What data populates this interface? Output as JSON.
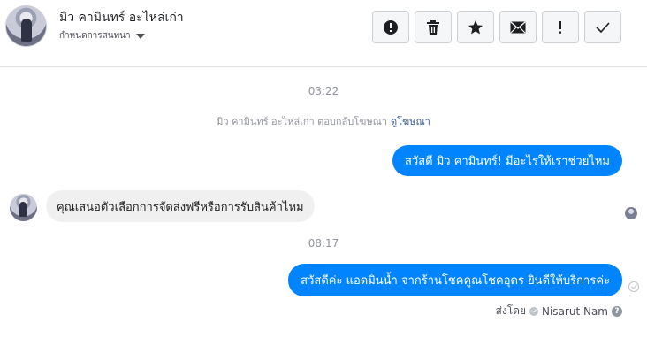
{
  "header": {
    "contact_name": "มิว คามินทร์ อะไหล่เก่า",
    "manage_label": "กำหนดการสนทนา",
    "toolbar": [
      {
        "name": "mark-spam-button",
        "icon": "alert-circle-icon"
      },
      {
        "name": "delete-button",
        "icon": "trash-icon"
      },
      {
        "name": "star-button",
        "icon": "star-icon"
      },
      {
        "name": "mark-unread-button",
        "icon": "envelope-icon"
      },
      {
        "name": "follow-up-button",
        "icon": "exclamation-icon"
      },
      {
        "name": "mark-done-button",
        "icon": "checkmark-icon"
      }
    ]
  },
  "conversation": {
    "timestamp_1": "03:22",
    "system_message": "มิว คามินทร์ อะไหล่เก่า ตอบกลับโฆษณา",
    "system_link": "ดูโฆษณา",
    "msg_out_1": "สวัสดี มิว คามินทร์! มีอะไรให้เราช่วยไหม",
    "msg_in_1": "คุณเสนอตัวเลือกการจัดส่งฟรีหรือการรับสินค้าไหม",
    "timestamp_2": "08:17",
    "msg_out_2": "สวัสดีค่ะ แอดมินน้ำ จากร้านโชคคูณโชคอุดร ยินดีให้บริการค่ะ",
    "sent_by_label": "ส่งโดย",
    "sent_by_name": "Nisarut Nam",
    "help_glyph": "?"
  },
  "colors": {
    "outgoing_bubble": "#0084ff",
    "incoming_bubble": "#f1f0f0",
    "muted_text": "#90949c",
    "link": "#365899"
  }
}
